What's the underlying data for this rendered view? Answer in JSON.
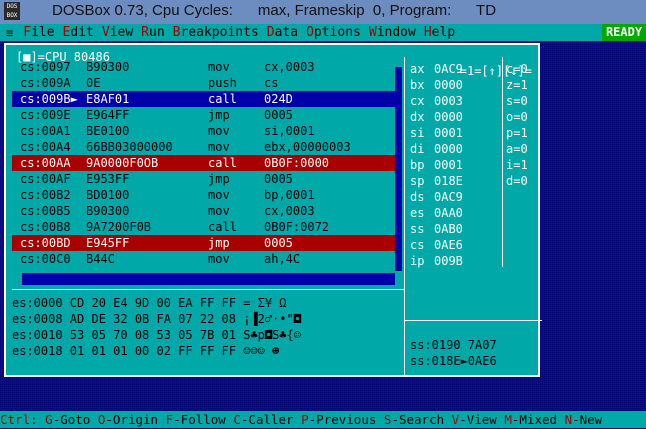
{
  "window": {
    "title": "DOSBox 0.73, Cpu Cycles:      max, Frameskip  0, Program:      TD",
    "logo_text": "DOS BOX"
  },
  "menu": {
    "system": "≡",
    "items": [
      {
        "hot": "F",
        "rest": "ile"
      },
      {
        "hot": "E",
        "rest": "dit"
      },
      {
        "hot": "V",
        "rest": "iew"
      },
      {
        "hot": "R",
        "rest": "un"
      },
      {
        "hot": "B",
        "rest": "reakpoints"
      },
      {
        "hot": "D",
        "rest": "ata"
      },
      {
        "hot": "O",
        "rest": "ptions"
      },
      {
        "hot": "W",
        "rest": "indow"
      },
      {
        "hot": "H",
        "rest": "elp"
      }
    ],
    "ready": "READY"
  },
  "cpu_window": {
    "header_left": "[■]=CPU 80486",
    "header_right": "=1=[↑][↓]="
  },
  "code": [
    {
      "addr": "cs:0097",
      "hex": "B90300",
      "mn": "mov",
      "op": "cx,0003",
      "state": ""
    },
    {
      "addr": "cs:009A",
      "hex": "0E",
      "mn": "push",
      "op": "cs",
      "state": ""
    },
    {
      "addr": "cs:009B►",
      "hex": "E8AF01",
      "mn": "call",
      "op": "024D",
      "state": "sel"
    },
    {
      "addr": "cs:009E",
      "hex": "E964FF",
      "mn": "jmp",
      "op": "0005",
      "state": ""
    },
    {
      "addr": "cs:00A1",
      "hex": "BE0100",
      "mn": "mov",
      "op": "si,0001",
      "state": ""
    },
    {
      "addr": "cs:00A4",
      "hex": "66BB03000000",
      "mn": "mov",
      "op": "ebx,00000003",
      "state": ""
    },
    {
      "addr": "cs:00AA",
      "hex": "9A0000F0OB",
      "mn": "call",
      "op": "0B0F:0000",
      "state": "bp"
    },
    {
      "addr": "cs:00AF",
      "hex": "E953FF",
      "mn": "jmp",
      "op": "0005",
      "state": ""
    },
    {
      "addr": "cs:00B2",
      "hex": "BD0100",
      "mn": "mov",
      "op": "bp,0001",
      "state": ""
    },
    {
      "addr": "cs:00B5",
      "hex": "B90300",
      "mn": "mov",
      "op": "cx,0003",
      "state": ""
    },
    {
      "addr": "cs:00B8",
      "hex": "9A7200F0B",
      "mn": "call",
      "op": "0B0F:0072",
      "state": ""
    },
    {
      "addr": "cs:00BD",
      "hex": "E945FF",
      "mn": "jmp",
      "op": "0005",
      "state": "bp"
    },
    {
      "addr": "cs:00C0",
      "hex": "B44C",
      "mn": "mov",
      "op": "ah,4C",
      "state": ""
    }
  ],
  "registers": [
    {
      "name": "ax",
      "value": "0AC9"
    },
    {
      "name": "bx",
      "value": "0000"
    },
    {
      "name": "cx",
      "value": "0003"
    },
    {
      "name": "dx",
      "value": "0000"
    },
    {
      "name": "si",
      "value": "0001"
    },
    {
      "name": "di",
      "value": "0000"
    },
    {
      "name": "bp",
      "value": "0001"
    },
    {
      "name": "sp",
      "value": "018E"
    },
    {
      "name": "ds",
      "value": "0AC9"
    },
    {
      "name": "es",
      "value": "0AA0"
    },
    {
      "name": "ss",
      "value": "0AB0"
    },
    {
      "name": "cs",
      "value": "0AE6"
    },
    {
      "name": "ip",
      "value": "009B"
    }
  ],
  "flags": [
    {
      "name": "c",
      "value": "0"
    },
    {
      "name": "z",
      "value": "1"
    },
    {
      "name": "s",
      "value": "0"
    },
    {
      "name": "o",
      "value": "0"
    },
    {
      "name": "p",
      "value": "1"
    },
    {
      "name": "a",
      "value": "0"
    },
    {
      "name": "i",
      "value": "1"
    },
    {
      "name": "d",
      "value": "0"
    }
  ],
  "dump": [
    "es:0000 CD 20 E4 9D 00 EA FF FF = Σ¥ Ω",
    "es:0008 AD DE 32 0B FA 07 22 08 ¡▐2♂·•\"◘",
    "es:0010 53 05 70 08 53 05 7B 01 S♣p◘S♣{☺",
    "es:0018 01 01 01 00 02 FF FF FF ☺☺☺ ☻"
  ],
  "stack": [
    "ss:0190 7A07",
    "ss:018E►0AE6"
  ],
  "status": [
    {
      "key": "Ctrl:",
      "text": " "
    },
    {
      "key": "G",
      "text": "-Goto "
    },
    {
      "key": "O",
      "text": "-Origin "
    },
    {
      "key": "F",
      "text": "-Follow "
    },
    {
      "key": "C",
      "text": "-Caller "
    },
    {
      "key": "P",
      "text": "-Previous "
    },
    {
      "key": "S",
      "text": "-Search "
    },
    {
      "key": "V",
      "text": "-View "
    },
    {
      "key": "M",
      "text": "-Mixed "
    },
    {
      "key": "N",
      "text": "-New"
    }
  ]
}
